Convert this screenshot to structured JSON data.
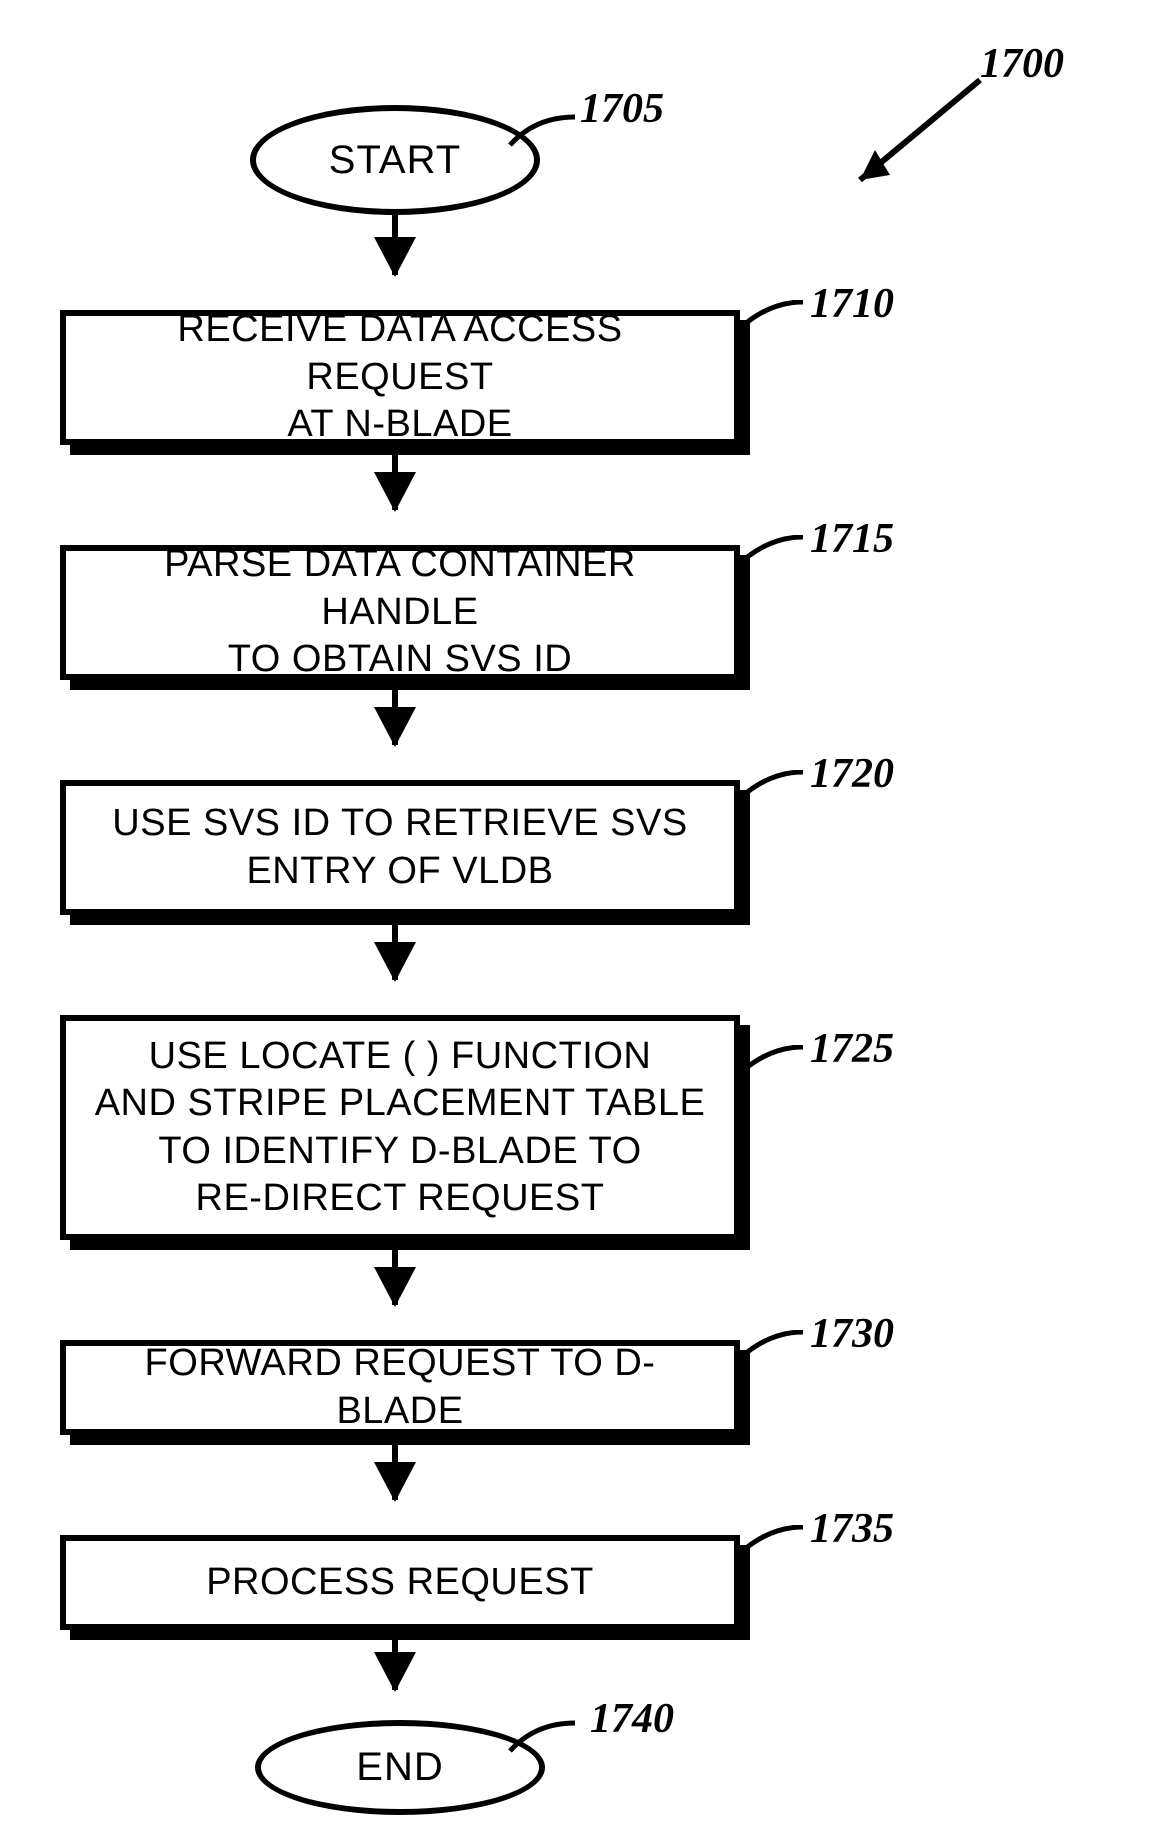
{
  "diagram": {
    "id_label": "1700",
    "start": {
      "text": "START",
      "ref": "1705"
    },
    "end": {
      "text": "END",
      "ref": "1740"
    },
    "steps": [
      {
        "ref": "1710",
        "text": "RECEIVE DATA ACCESS REQUEST\nAT N-BLADE"
      },
      {
        "ref": "1715",
        "text": "PARSE DATA CONTAINER HANDLE\nTO OBTAIN SVS ID"
      },
      {
        "ref": "1720",
        "text": "USE SVS ID TO RETRIEVE SVS\nENTRY OF VLDB"
      },
      {
        "ref": "1725",
        "text": "USE LOCATE ( ) FUNCTION\nAND STRIPE PLACEMENT TABLE\nTO IDENTIFY D-BLADE TO\nRE-DIRECT REQUEST"
      },
      {
        "ref": "1730",
        "text": "FORWARD REQUEST TO D-BLADE"
      },
      {
        "ref": "1735",
        "text": "PROCESS REQUEST"
      }
    ]
  }
}
